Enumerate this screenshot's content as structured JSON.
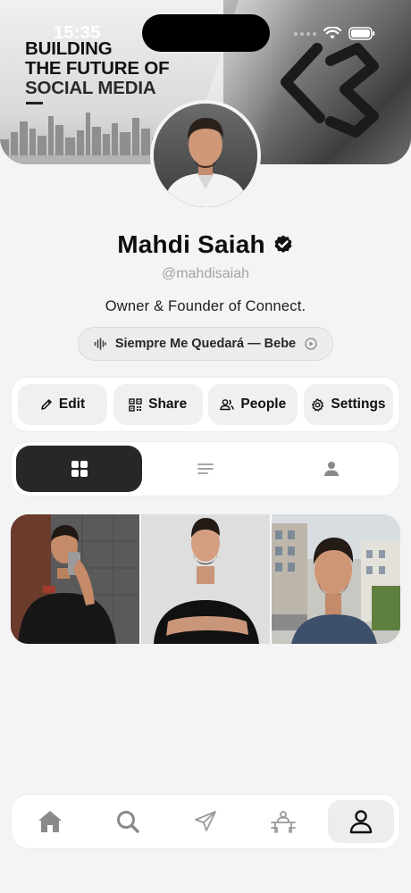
{
  "status_bar": {
    "time": "15:35"
  },
  "banner": {
    "headline": [
      "BUILDING",
      "THE FUTURE OF",
      "SOCIAL MEDIA"
    ]
  },
  "profile": {
    "name": "Mahdi Saiah",
    "handle": "@mahdisaiah",
    "bio": "Owner & Founder of Connect.",
    "verified": true
  },
  "music": {
    "track": "Siempre Me Quedará — Bebe"
  },
  "actions": [
    {
      "label": "Edit",
      "icon": "pencil-icon"
    },
    {
      "label": "Share",
      "icon": "qr-code-icon"
    },
    {
      "label": "People",
      "icon": "people-icon"
    },
    {
      "label": "Settings",
      "icon": "gear-icon"
    }
  ],
  "tabs": [
    {
      "name": "grid",
      "icon": "grid-icon",
      "active": true
    },
    {
      "name": "list",
      "icon": "list-icon",
      "active": false
    },
    {
      "name": "tagged",
      "icon": "person-icon",
      "active": false
    }
  ],
  "bottom_nav": [
    {
      "name": "home",
      "icon": "home-icon",
      "active": false
    },
    {
      "name": "search",
      "icon": "search-icon",
      "active": false
    },
    {
      "name": "send",
      "icon": "send-icon",
      "active": false
    },
    {
      "name": "dining",
      "icon": "dining-icon",
      "active": false
    },
    {
      "name": "profile",
      "icon": "profile-icon",
      "active": true
    }
  ],
  "colors": {
    "background": "#f4f4f5",
    "card": "#ffffff",
    "active_tab": "#272727",
    "button_bg": "#f0f0f0",
    "muted_text": "#a3a3a3"
  }
}
